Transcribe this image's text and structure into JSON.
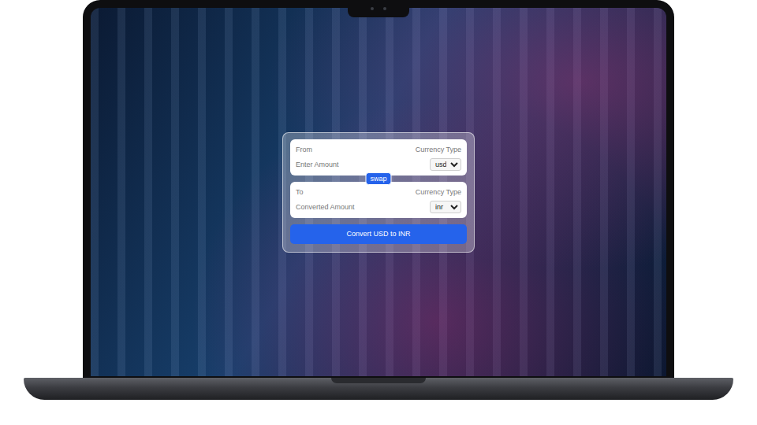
{
  "converter": {
    "from": {
      "label": "From",
      "currency_label": "Currency Type",
      "placeholder": "Enter Amount",
      "currency": "usd"
    },
    "swap_button": "swap",
    "to": {
      "label": "To",
      "currency_label": "Currency Type",
      "placeholder": "Converted Amount",
      "currency": "inr"
    },
    "convert_button": "Convert USD to INR"
  }
}
